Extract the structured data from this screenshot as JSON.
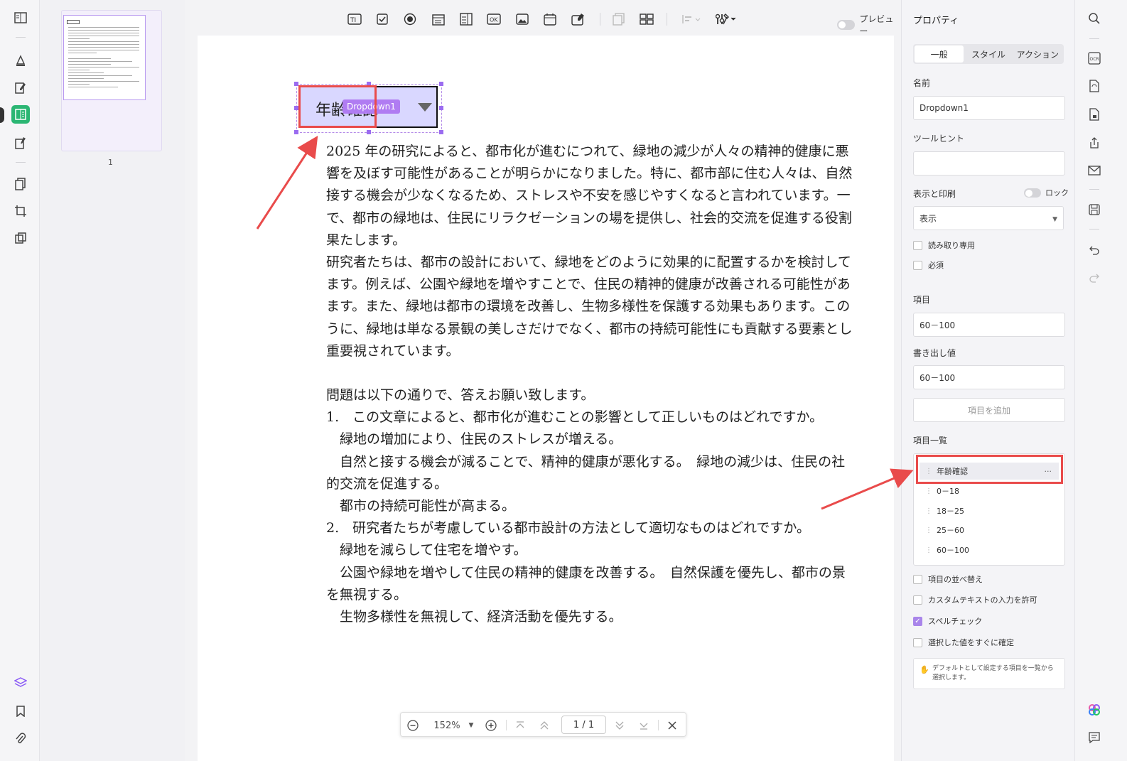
{
  "toolbar": {
    "preview_label": "プレビュー",
    "tools": [
      {
        "name": "text-field",
        "glyph": "TI"
      },
      {
        "name": "checkbox",
        "glyph": "☑"
      },
      {
        "name": "radio-button",
        "glyph": "◉"
      },
      {
        "name": "combo-box",
        "glyph": "▤"
      },
      {
        "name": "list-box",
        "glyph": "▥"
      },
      {
        "name": "push-button",
        "glyph": "OK"
      },
      {
        "name": "image-field",
        "glyph": "▨"
      },
      {
        "name": "date-field",
        "glyph": "▦"
      },
      {
        "name": "signature-field",
        "glyph": "✎"
      }
    ]
  },
  "thumbnail": {
    "page_number": "1"
  },
  "document": {
    "dropdown_text": "年齢確認",
    "dropdown_tag": "Dropdown1",
    "lines": [
      "2025 年の研究によると、都市化が進むにつれて、緑地の減少が人々の精神的健康に悪",
      "響を及ぼす可能性があることが明らかになりました。特に、都市部に住む人々は、自然",
      "接する機会が少なくなるため、ストレスや不安を感じやすくなると言われています。一",
      "で、都市の緑地は、住民にリラクゼーションの場を提供し、社会的交流を促進する役割",
      "果たします。",
      "研究者たちは、都市の設計において、緑地をどのように効果的に配置するかを検討して",
      "ます。例えば、公園や緑地を増やすことで、住民の精神的健康が改善される可能性があ",
      "ます。また、緑地は都市の環境を改善し、生物多様性を保護する効果もあります。この",
      "うに、緑地は単なる景観の美しさだけでなく、都市の持続可能性にも貢献する要素とし",
      "重要視されています。",
      "",
      "問題は以下の通りで、答えお願い致します。",
      "1.　この文章によると、都市化が進むことの影響として正しいものはどれですか。",
      "　緑地の増加により、住民のストレスが増える。",
      "　自然と接する機会が減ることで、精神的健康が悪化する。　緑地の減少は、住民の社",
      "的交流を促進する。",
      "　都市の持続可能性が高まる。",
      "2.　研究者たちが考慮している都市設計の方法として適切なものはどれですか。",
      "　緑地を減らして住宅を増やす。",
      "　公園や緑地を増やして住民の精神的健康を改善する。　自然保護を優先し、都市の景",
      "を無視する。",
      "　生物多様性を無視して、経済活動を優先する。"
    ]
  },
  "zoom": {
    "level": "152%",
    "page": "1 / 1"
  },
  "properties": {
    "title": "プロパティ",
    "tabs": [
      "一般",
      "スタイル",
      "アクション"
    ],
    "name_label": "名前",
    "name_value": "Dropdown1",
    "tooltip_label": "ツールヒント",
    "tooltip_value": "",
    "display_label": "表示と印刷",
    "lock_label": "ロック",
    "display_value": "表示",
    "readonly_label": "読み取り専用",
    "required_label": "必須",
    "item_label": "項目",
    "item_value": "60－100",
    "export_label": "書き出し値",
    "export_value": "60－100",
    "add_item_label": "項目を追加",
    "item_list_label": "項目一覧",
    "items": [
      "年齢確認",
      "0－18",
      "18－25",
      "25－60",
      "60－100"
    ],
    "sort_label": "項目の並べ替え",
    "custom_text_label": "カスタムテキストの入力を許可",
    "spellcheck_label": "スペルチェック",
    "commit_label": "選択した値をすぐに確定",
    "hint_text": "デフォルトとして設定する項目を一覧から選択します。"
  }
}
